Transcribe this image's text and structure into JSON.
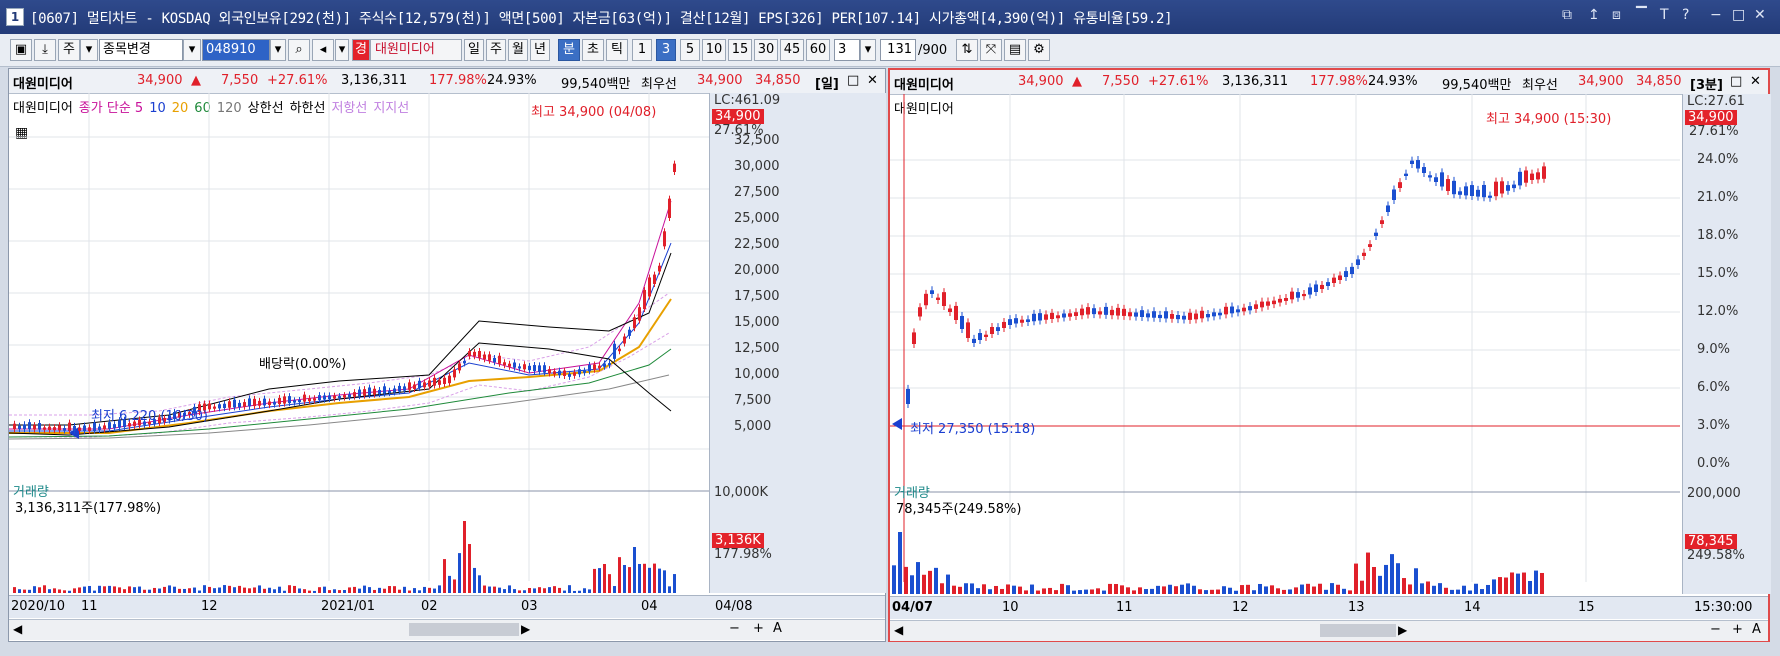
{
  "window": {
    "number": "1",
    "title": "[0607] 멀티차트 - KOSDAQ 외국인보유[292(천)] 주식수[12,579(천)] 액면[500] 자본금[63(억)] 결산[12월] EPS[326] PER[107.14] 시가총액[4,390(억)] 유통비율[59.2]",
    "controls": [
      "⧉",
      "↥",
      "⧈",
      "▔",
      "T",
      "?",
      "−",
      "□",
      "✕"
    ]
  },
  "toolbar": {
    "market_label": "주",
    "change_label": "종목변경",
    "code": "048910",
    "stock_badge": "경",
    "stock_name": "대원미디어",
    "period_buttons": [
      "일",
      "주",
      "월",
      "년",
      "분",
      "초",
      "틱"
    ],
    "selected_period": "분",
    "interval_buttons": [
      "1",
      "3",
      "5",
      "10",
      "15",
      "30",
      "45",
      "60"
    ],
    "selected_interval": "3",
    "interval_value": "3",
    "count_value": "131",
    "count_max": "/900"
  },
  "left_panel": {
    "name": "대원미디어",
    "price": "34,900",
    "change": "7,550",
    "change_pct": "+27.61%",
    "volume": "3,136,311",
    "vol_ratio": "177.98%",
    "turnover": "24.93%",
    "amount": "99,540백만",
    "ask_label": "최우선",
    "ask": "34,900",
    "bid": "34,850",
    "period_tag": "[일]",
    "legend_stock": "대원미디어",
    "legend_ma": [
      "종가 단순 5",
      "10",
      "20",
      "60",
      "120"
    ],
    "legend_lines": [
      "상한선",
      "하한선",
      "저항선",
      "지지선"
    ],
    "lc_label": "LC:461.09",
    "price_box": "34,900",
    "price_box_pct": "27.61%",
    "y_labels": [
      "32,500",
      "30,000",
      "27,500",
      "25,000",
      "22,500",
      "20,000",
      "17,500",
      "15,000",
      "12,500",
      "10,000",
      "7,500",
      "5,000"
    ],
    "high_ann": "최고 34,900 (04/08)",
    "low_ann": "최저 6,220 (10/30)",
    "dividend_ann": "배당락(0.00%)",
    "vol_title": "거래량",
    "vol_value": "3,136,311주(177.98%)",
    "vol_axis": "10,000K",
    "vol_box": "3,136K",
    "vol_box_pct": "177.98%",
    "x_labels": [
      "2020/10",
      "11",
      "12",
      "2021/01",
      "02",
      "03",
      "04"
    ],
    "x_end": "04/08"
  },
  "right_panel": {
    "name": "대원미디어",
    "price": "34,900",
    "change": "7,550",
    "change_pct": "+27.61%",
    "volume": "3,136,311",
    "vol_ratio": "177.98%",
    "turnover": "24.93%",
    "amount": "99,540백만",
    "ask_label": "최우선",
    "ask": "34,900",
    "bid": "34,850",
    "period_tag": "[3분]",
    "legend_stock": "대원미디어",
    "lc_label": "LC:27.61",
    "price_box": "34,900",
    "price_box_pct": "27.61%",
    "y_labels": [
      "24.0%",
      "21.0%",
      "18.0%",
      "15.0%",
      "12.0%",
      "9.0%",
      "6.0%",
      "3.0%",
      "0.0%"
    ],
    "high_ann": "최고 34,900 (15:30)",
    "low_ann": "최저 27,350 (15:18)",
    "vol_title": "거래량",
    "vol_value": "78,345주(249.58%)",
    "vol_axis": "200,000",
    "vol_box": "78,345",
    "vol_box_pct": "249.58%",
    "x_labels": [
      "04/07",
      "10",
      "11",
      "12",
      "13",
      "14",
      "15"
    ],
    "x_end": "15:30:00"
  },
  "colors": {
    "up": "#e0202a",
    "down": "#1a4fd0",
    "title_bg": "#233b78",
    "selected": "#3b6fc4"
  }
}
